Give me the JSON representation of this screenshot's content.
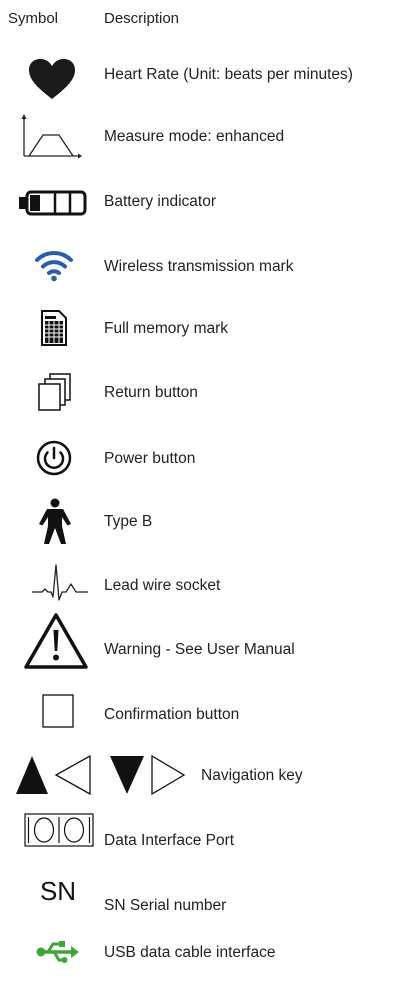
{
  "header": {
    "symbol": "Symbol",
    "description": "Description"
  },
  "rows": [
    {
      "icon": "heart-icon",
      "text": "Heart Rate (Unit: beats per minutes)"
    },
    {
      "icon": "measure-mode-icon",
      "text": "Measure mode: enhanced"
    },
    {
      "icon": "battery-icon",
      "text": "Battery indicator"
    },
    {
      "icon": "wireless-icon",
      "text": "Wireless transmission mark",
      "color": "#2a5ea8"
    },
    {
      "icon": "memory-card-icon",
      "text": "Full memory mark"
    },
    {
      "icon": "return-icon",
      "text": "Return button"
    },
    {
      "icon": "power-icon",
      "text": "Power button"
    },
    {
      "icon": "type-b-body-icon",
      "text": "Type B"
    },
    {
      "icon": "ecg-wave-icon",
      "text": "Lead wire socket"
    },
    {
      "icon": "warning-icon",
      "text": "Warning - See User Manual"
    },
    {
      "icon": "square-icon",
      "text": "Confirmation button"
    },
    {
      "icon": "navigation-arrows-icon",
      "text": "Navigation key"
    },
    {
      "icon": "data-port-icon",
      "text": "Data Interface Port"
    },
    {
      "icon": "sn-icon",
      "glyph": "SN",
      "text": "SN Serial number"
    },
    {
      "icon": "usb-icon",
      "text": "USB data cable interface",
      "color": "#3fa535"
    }
  ]
}
